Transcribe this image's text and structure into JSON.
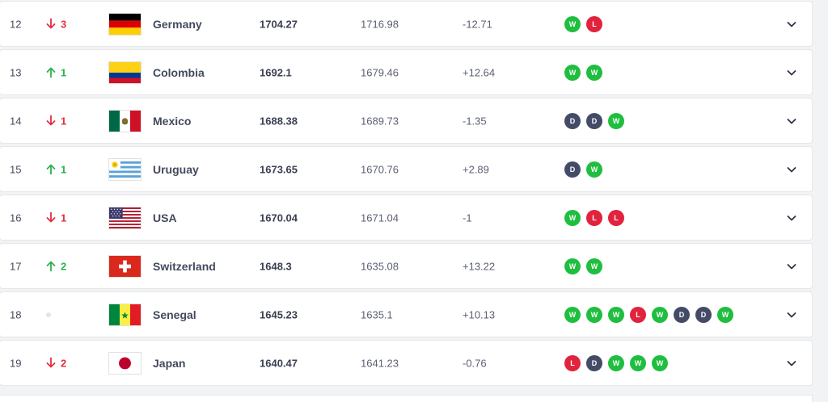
{
  "rows": [
    {
      "rank": "12",
      "move": {
        "dir": "down",
        "value": "3"
      },
      "country": "Germany",
      "flag": "germany-flag",
      "points": "1704.27",
      "previous": "1716.98",
      "change": "-12.71",
      "form": [
        "W",
        "L"
      ]
    },
    {
      "rank": "13",
      "move": {
        "dir": "up",
        "value": "1"
      },
      "country": "Colombia",
      "flag": "colombia-flag",
      "points": "1692.1",
      "previous": "1679.46",
      "change": "+12.64",
      "form": [
        "W",
        "W"
      ]
    },
    {
      "rank": "14",
      "move": {
        "dir": "down",
        "value": "1"
      },
      "country": "Mexico",
      "flag": "mexico-flag",
      "points": "1688.38",
      "previous": "1689.73",
      "change": "-1.35",
      "form": [
        "D",
        "D",
        "W"
      ]
    },
    {
      "rank": "15",
      "move": {
        "dir": "up",
        "value": "1"
      },
      "country": "Uruguay",
      "flag": "uruguay-flag",
      "points": "1673.65",
      "previous": "1670.76",
      "change": "+2.89",
      "form": [
        "D",
        "W"
      ]
    },
    {
      "rank": "16",
      "move": {
        "dir": "down",
        "value": "1"
      },
      "country": "USA",
      "flag": "usa-flag",
      "points": "1670.04",
      "previous": "1671.04",
      "change": "-1",
      "form": [
        "W",
        "L",
        "L"
      ]
    },
    {
      "rank": "17",
      "move": {
        "dir": "up",
        "value": "2"
      },
      "country": "Switzerland",
      "flag": "switzerland-flag",
      "points": "1648.3",
      "previous": "1635.08",
      "change": "+13.22",
      "form": [
        "W",
        "W"
      ]
    },
    {
      "rank": "18",
      "move": {
        "dir": "same",
        "value": ""
      },
      "country": "Senegal",
      "flag": "senegal-flag",
      "points": "1645.23",
      "previous": "1635.1",
      "change": "+10.13",
      "form": [
        "W",
        "W",
        "W",
        "L",
        "W",
        "D",
        "D",
        "W"
      ]
    },
    {
      "rank": "19",
      "move": {
        "dir": "down",
        "value": "2"
      },
      "country": "Japan",
      "flag": "japan-flag",
      "points": "1640.47",
      "previous": "1641.23",
      "change": "-0.76",
      "form": [
        "L",
        "D",
        "W",
        "W",
        "W"
      ]
    }
  ],
  "colors": {
    "win": "#1fbe3f",
    "loss": "#e1233d",
    "draw": "#444b66",
    "up": "#2db24a",
    "down": "#e0303f"
  },
  "icons": {
    "expand": "chevron-down-icon",
    "up": "arrow-up-icon",
    "down": "arrow-down-icon",
    "same": "no-change-dot-icon"
  }
}
